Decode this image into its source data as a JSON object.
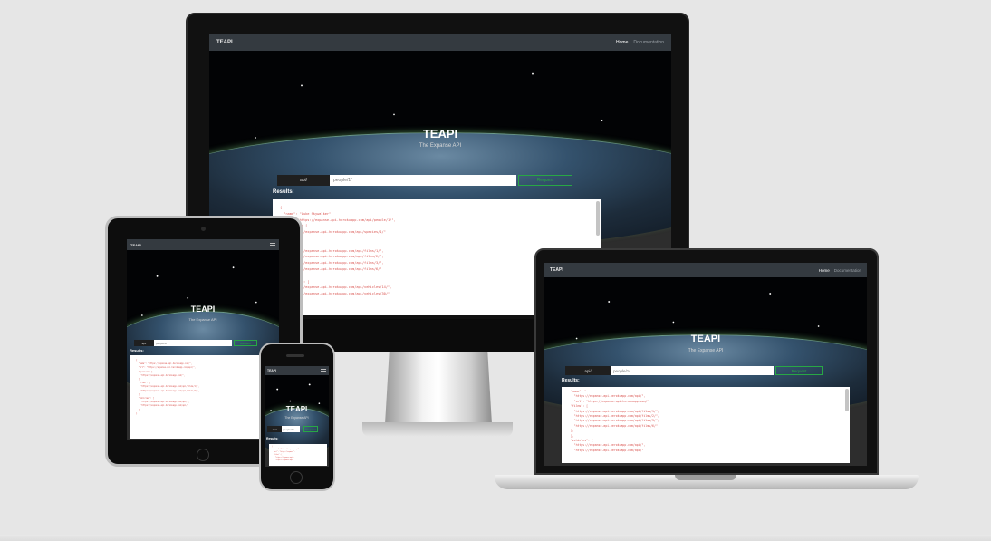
{
  "app": {
    "brand": "TEAPI",
    "nav_links": [
      "Home",
      "Documentation"
    ],
    "hero_title": "TEAPI",
    "hero_subtitle": "The Expanse API",
    "request_prefix": "api/",
    "input_placeholder": "people/1/",
    "request_button": "Request",
    "results_label": "Results:"
  },
  "imac_code": [
    "{",
    "  \"name\": \"Luke Skywalker\",",
    "  \"url\": \"https://expanse-api.herokuapp.com/api/people/1/\",",
    "  \"species\": [",
    "    \"https://expanse-api.herokuapp.com/api/species/1/\"",
    "  ],",
    "  \"films\": [",
    "    \"https://expanse-api.herokuapp.com/api/films/1/\",",
    "    \"https://expanse-api.herokuapp.com/api/films/2/\",",
    "    \"https://expanse-api.herokuapp.com/api/films/3/\",",
    "    \"https://expanse-api.herokuapp.com/api/films/6/\"",
    "  ],",
    "  \"vehicles\": [",
    "    \"https://expanse-api.herokuapp.com/api/vehicles/14/\",",
    "    \"https://expanse-api.herokuapp.com/api/vehicles/30/\""
  ],
  "macbook_code": [
    "  \"name\": \"",
    "    \"https://expanse-api.herokuapp.com/api/\",",
    "    \"url\": \"https://expanse-api.herokuapp.com/\"",
    "  \"films\": [",
    "    \"https://expanse-api.herokuapp.com/api/films/1/\",",
    "    \"https://expanse-api.herokuapp.com/api/films/2/\",",
    "    \"https://expanse-api.herokuapp.com/api/films/3/\",",
    "    \"https://expanse-api.herokuapp.com/api/films/6/\"",
    "  ],",
    "  ],",
    "  \"vehicles\": [",
    "    \"https://expanse-api.herokuapp.com/api/\",",
    "    \"https://expanse-api.herokuapp.com/api/\""
  ],
  "ipad_code": [
    "{",
    "  \"name\": \"https://expanse-api.herokuapp.com/\",",
    "  \"url\": \"https://expanse-api.herokuapp.com/api/\",",
    "  \"species\": [",
    "    \"https://expanse-api.herokuapp.com/\",",
    "  ],",
    "  \"films\": [",
    "    \"https://expanse-api.herokuapp.com/api/films/1/\",",
    "    \"https://expanse-api.herokuapp.com/api/films/2/\",",
    "  ],",
    "  \"vehicles\": [",
    "    \"https://expanse-api.herokuapp.com/api/\",",
    "    \"https://expanse-api.herokuapp.com/api/\"",
    "  ],",
    "}"
  ],
  "iphone_code": [
    "{",
    "  \"name\": \"https://expanse-api\",",
    "  \"url\": \"https://expanse\",",
    "  \"films\": [",
    "    \"https://expanse-api\",",
    "    \"https://expanse-api\""
  ]
}
